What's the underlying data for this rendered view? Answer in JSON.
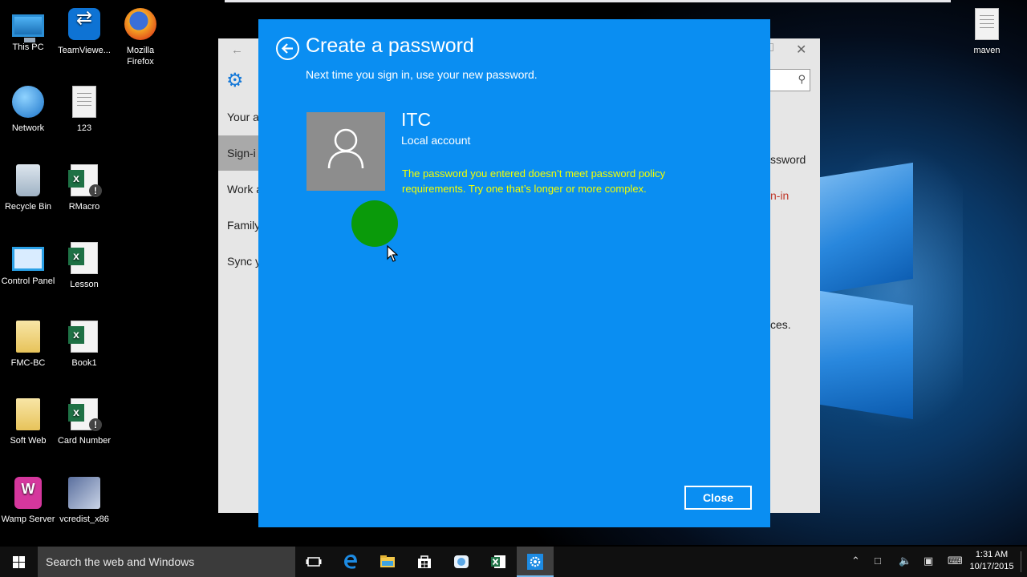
{
  "desktop": {
    "icons": [
      {
        "label": "This PC",
        "icon": "computer-icon"
      },
      {
        "label": "TeamViewe...",
        "icon": "teamviewer-icon"
      },
      {
        "label": "Mozilla Firefox",
        "icon": "firefox-icon"
      },
      {
        "label": "maven",
        "icon": "document-icon"
      },
      {
        "label": "Network",
        "icon": "network-icon"
      },
      {
        "label": "123",
        "icon": "document-icon"
      },
      {
        "label": "Recycle Bin",
        "icon": "recycle-bin-icon"
      },
      {
        "label": "RMacro",
        "icon": "excel-icon"
      },
      {
        "label": "Control Panel",
        "icon": "control-panel-icon"
      },
      {
        "label": "Lesson",
        "icon": "excel-icon"
      },
      {
        "label": "FMC-BC",
        "icon": "folder-icon"
      },
      {
        "label": "Book1",
        "icon": "excel-icon"
      },
      {
        "label": "Soft Web",
        "icon": "folder-icon"
      },
      {
        "label": "Card Number",
        "icon": "excel-icon"
      },
      {
        "label": "Wamp Server",
        "icon": "wamp-icon"
      },
      {
        "label": "vcredist_x86",
        "icon": "installer-icon"
      }
    ]
  },
  "settings_window": {
    "nav": [
      "Your a",
      "Sign-i",
      "Work a",
      "Family",
      "Sync y"
    ],
    "active_nav_index": 1,
    "right_fragments": [
      "ssword",
      "n-in",
      "ces."
    ]
  },
  "dialog": {
    "title": "Create a password",
    "subtitle": "Next time you sign in, use your new password.",
    "account_name": "ITC",
    "account_type": "Local account",
    "error": "The password you entered doesn’t meet password policy requirements. Try one that’s longer or more complex.",
    "close_label": "Close",
    "background_color": "#0a8ef2",
    "error_color": "#f3ff00"
  },
  "taskbar": {
    "search_placeholder": "Search the web and Windows",
    "apps": [
      "task-view-icon",
      "edge-icon",
      "file-explorer-icon",
      "store-icon",
      "people-icon",
      "excel-icon",
      "settings-icon"
    ],
    "active_app": "settings-icon",
    "time": "1:31 AM",
    "date": "10/17/2015"
  }
}
